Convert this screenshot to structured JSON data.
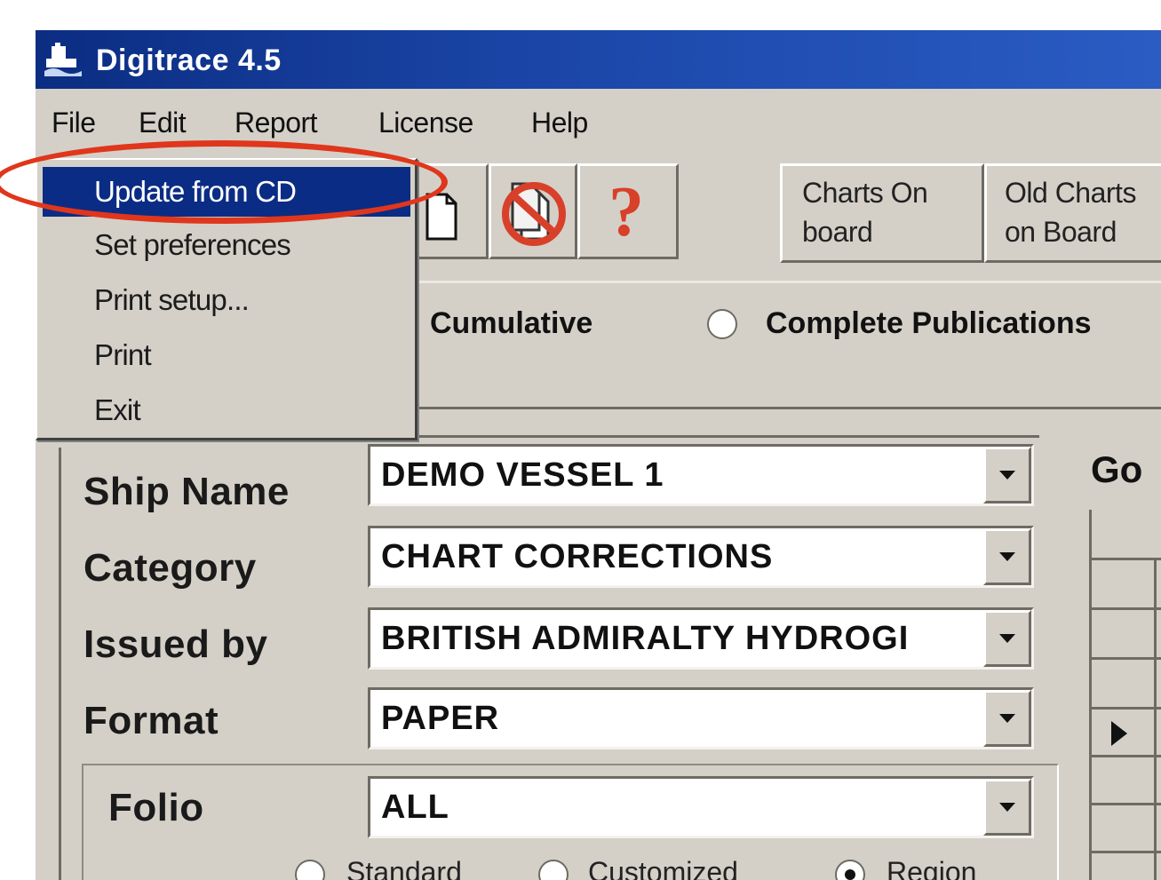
{
  "window": {
    "title": "Digitrace 4.5",
    "icon": "digitrace-app-icon"
  },
  "menubar": {
    "items": [
      "File",
      "Edit",
      "Report",
      "License",
      "Help"
    ]
  },
  "file_menu": {
    "items": [
      "Update from CD",
      "Set preferences",
      "Print setup...",
      "Print",
      "Exit"
    ],
    "highlighted": "Update from CD"
  },
  "toolbar": {
    "icons": [
      "document-icon",
      "cancel-documents-icon",
      "help-question-icon"
    ],
    "help_glyph": "?",
    "buttons": [
      {
        "line1": "Charts On",
        "line2": "board"
      },
      {
        "line1": "Old Charts",
        "line2": "on Board"
      }
    ]
  },
  "options": {
    "cumulative": "Cumulative",
    "complete_publications": "Complete Publications"
  },
  "form": {
    "ship_name": {
      "label": "Ship Name",
      "value": "DEMO VESSEL 1"
    },
    "category": {
      "label": "Category",
      "value": "CHART CORRECTIONS"
    },
    "issued_by": {
      "label": "Issued by",
      "value": "BRITISH ADMIRALTY HYDROGI"
    },
    "format": {
      "label": "Format",
      "value": "PAPER"
    },
    "folio": {
      "label": "Folio",
      "value": "ALL"
    },
    "folio_modes": {
      "standard": "Standard",
      "customized": "Customized",
      "region": "Region",
      "selected": "Region"
    }
  },
  "go_label": "Go",
  "colors": {
    "titlebar": "#0b2d82",
    "face": "#d4d0c8",
    "highlight": "#0a2c84",
    "annotation": "#e0361c",
    "help_mark": "#d8402a"
  }
}
